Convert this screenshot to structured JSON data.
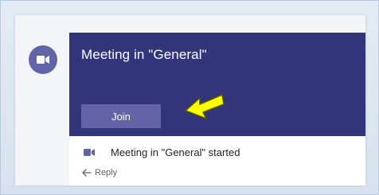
{
  "meeting_card": {
    "title": "Meeting in \"General\"",
    "join_label": "Join"
  },
  "thread": {
    "message": "Meeting in \"General\" started",
    "reply_label": "Reply"
  },
  "icons": {
    "avatar": "video-camera-icon",
    "message": "video-camera-icon",
    "reply": "reply-arrow-icon",
    "annotation": "yellow-arrow-icon"
  },
  "colors": {
    "card_background": "#33357a",
    "accent": "#6264a7",
    "annotation_arrow": "#ffff00"
  }
}
